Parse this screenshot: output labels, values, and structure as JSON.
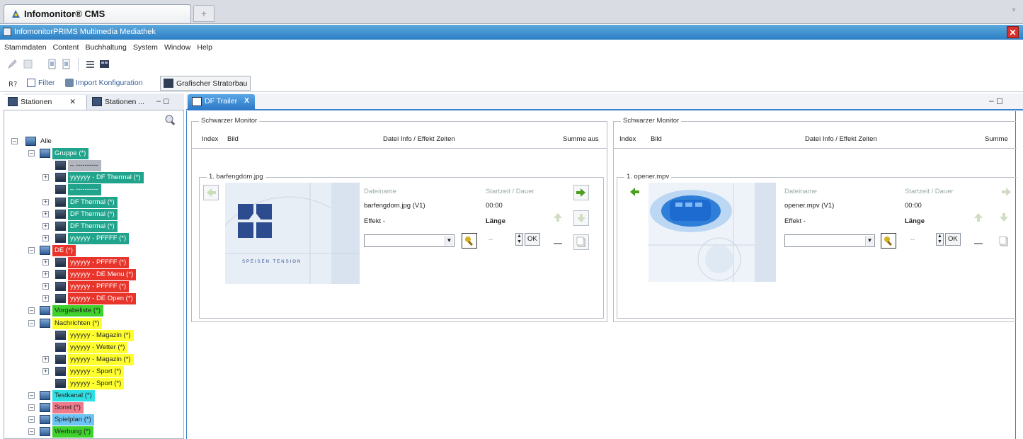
{
  "browser": {
    "tab_title": "Infomonitor® CMS",
    "new_tab": "+",
    "scroll_hint": "▾"
  },
  "window": {
    "title": "InfomonitorPRIMS  Multimedia Mediathek",
    "close": "✕"
  },
  "menu": [
    "Stammdaten",
    "Content",
    "Buchhaltung",
    "System",
    "Window",
    "Help"
  ],
  "toolbar": {
    "icons": [
      "pencil-icon",
      "disk-icon",
      "page-icon",
      "page-icon",
      "list-icon",
      "film-icon"
    ]
  },
  "perspectives": {
    "items": [
      "Filter",
      "Import Konfiguration"
    ],
    "selected": "Grafischer Stratorbau"
  },
  "left_panel": {
    "tabs": [
      "Stationen",
      "Stationen ..."
    ],
    "tab_close": "✕",
    "tab_controls": "– ◻",
    "tree": [
      {
        "label": "Alle",
        "color": "",
        "depth": 0
      },
      {
        "label": "Gruppe (*)",
        "color": "#21a48c",
        "depth": 1
      },
      {
        "label": "– ----------",
        "color": "#b2b7bf",
        "depth": 2
      },
      {
        "label": "yyyyyy - DF Thermal (*)",
        "color": "#21a48c",
        "depth": 2
      },
      {
        "label": "– ----------",
        "color": "#21a48c",
        "depth": 2
      },
      {
        "label": "DF Thermal (*)",
        "color": "#21a48c",
        "depth": 2
      },
      {
        "label": "DF Thermal (*)",
        "color": "#21a48c",
        "depth": 2
      },
      {
        "label": "DF Thermal (*)",
        "color": "#21a48c",
        "depth": 2
      },
      {
        "label": "yyyyyy - PFFFF (*)",
        "color": "#21a48c",
        "depth": 2
      },
      {
        "label": "DE (*)",
        "color": "#e8342a",
        "depth": 1
      },
      {
        "label": "yyyyyy - PFFFF (*)",
        "color": "#e8342a",
        "depth": 2
      },
      {
        "label": "yyyyyy - DE Menu (*)",
        "color": "#e8342a",
        "depth": 2
      },
      {
        "label": "yyyyyy - PFFFF (*)",
        "color": "#e8342a",
        "depth": 2
      },
      {
        "label": "yyyyyy - DE Open (*)",
        "color": "#e8342a",
        "depth": 2
      },
      {
        "label": "Vorgabeliste (*)",
        "color": "#3fd22c",
        "depth": 1
      },
      {
        "label": "Nachrichten (*)",
        "color": "#ffff30",
        "depth": 1
      },
      {
        "label": "yyyyyy - Magazin (*)",
        "color": "#ffff30",
        "depth": 2
      },
      {
        "label": "yyyyyy - Wetter (*)",
        "color": "#ffff30",
        "depth": 2
      },
      {
        "label": "yyyyyy - Magazin (*)",
        "color": "#ffff30",
        "depth": 2
      },
      {
        "label": "yyyyyy - Sport (*)",
        "color": "#ffff30",
        "depth": 2
      },
      {
        "label": "yyyyyy - Sport (*)",
        "color": "#ffff30",
        "depth": 2
      },
      {
        "label": "Testkanal (*)",
        "color": "#2ee0e4",
        "depth": 1
      },
      {
        "label": "Sonst (*)",
        "color": "#f07a8c",
        "depth": 1
      },
      {
        "label": "Spielplan (*)",
        "color": "#6cc4f4",
        "depth": 1
      },
      {
        "label": "Werbung (*)",
        "color": "#3fd22c",
        "depth": 1
      }
    ]
  },
  "editor": {
    "tab_title": "DF Trailer",
    "tab_close": "X",
    "controls": "– ◻",
    "monitors": [
      {
        "title": "Schwarzer Monitor",
        "headers": [
          "Index",
          "Bild",
          "Datei Info / Effekt Zeiten",
          "Summe aus"
        ],
        "file_title": "1. barfengdom.jpg",
        "info_label_1": "Dateiname",
        "info_value_1": "barfengdom.jpg (V1)",
        "info_label_2": "Effekt",
        "info_value_2": "Effekt -",
        "time_label": "Startzeit / Dauer",
        "time_value": "00:00",
        "length_label": "Länge",
        "dash": "--",
        "ok": "OK",
        "logo_text": "SPEISEN TENSION"
      },
      {
        "title": "Schwarzer Monitor",
        "headers": [
          "Index",
          "Bild",
          "Datei Info / Effekt Zeiten",
          "Summe"
        ],
        "file_title": "1. opener.mpv",
        "info_label_1": "Dateiname",
        "info_value_1": "opener.mpv (V1)",
        "info_label_2": "Effekt",
        "info_value_2": "Effekt -",
        "time_label": "Startzeit / Dauer",
        "time_value": "00:00",
        "length_label": "Länge",
        "dash": "--",
        "ok": "OK"
      }
    ]
  }
}
